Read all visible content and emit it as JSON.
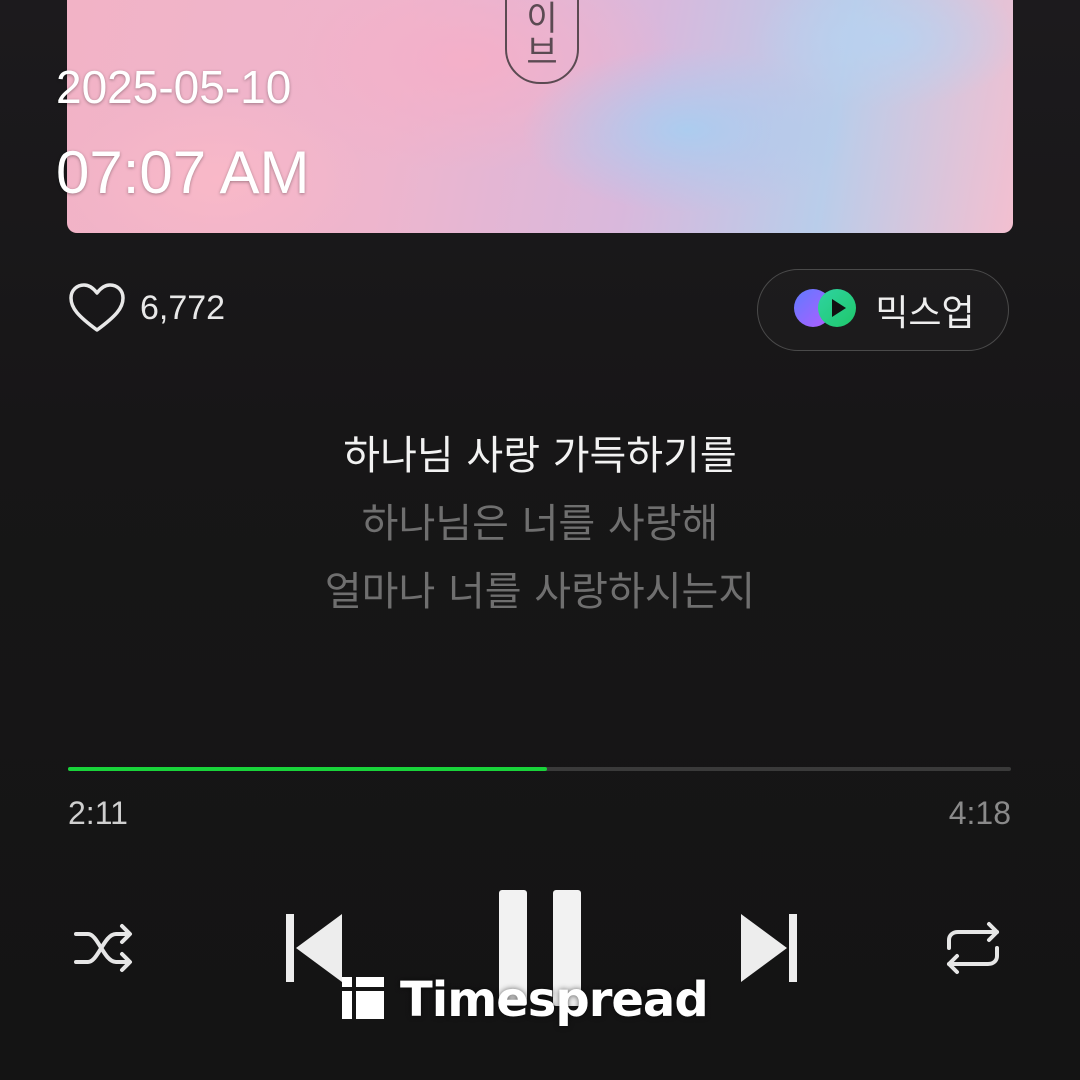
{
  "status": {
    "date": "2025-05-10",
    "time": "07:07 AM"
  },
  "album": {
    "sign_text": "이\n브"
  },
  "like": {
    "icon": "heart-outline-icon",
    "count": "6,772"
  },
  "mixup": {
    "icon": "mixup-icon",
    "label": "믹스업"
  },
  "lyrics": {
    "current": "하나님 사랑 가득하기를",
    "next": [
      "하나님은 너를 사랑해",
      "얼마나 너를 사랑하시는지"
    ]
  },
  "player": {
    "elapsed": "2:11",
    "total": "4:18",
    "progress_fraction": 0.508,
    "accent_color": "#19d33a"
  },
  "controls": {
    "shuffle_icon": "shuffle-icon",
    "prev_icon": "skip-previous-icon",
    "pause_icon": "pause-icon",
    "next_icon": "skip-next-icon",
    "repeat_icon": "repeat-icon"
  },
  "watermark": {
    "text": "Timespread"
  }
}
